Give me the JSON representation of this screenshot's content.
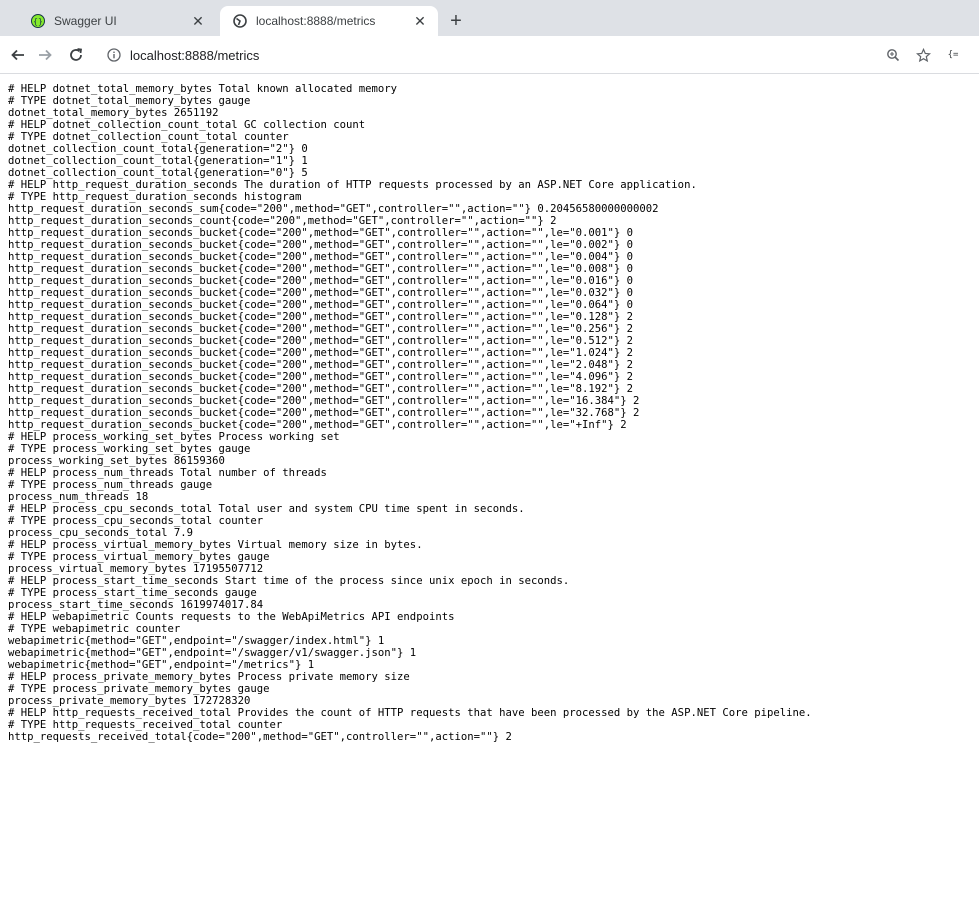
{
  "browser": {
    "tabs": [
      {
        "title": "Swagger UI",
        "active": false,
        "icon": "swagger-icon"
      },
      {
        "title": "localhost:8888/metrics",
        "active": true,
        "icon": "globe-icon"
      }
    ],
    "url": "localhost:8888/metrics",
    "nav_icons": [
      "back-arrow-icon",
      "forward-arrow-icon",
      "reload-icon",
      "info-icon",
      "zoom-icon",
      "star-icon",
      "extension-icon"
    ],
    "colors": {
      "tabstrip": "#dee1e6",
      "swagger_green": "#85ea2d",
      "swagger_dark": "#173647"
    }
  },
  "metrics_lines": [
    "# HELP dotnet_total_memory_bytes Total known allocated memory",
    "# TYPE dotnet_total_memory_bytes gauge",
    "dotnet_total_memory_bytes 2651192",
    "# HELP dotnet_collection_count_total GC collection count",
    "# TYPE dotnet_collection_count_total counter",
    "dotnet_collection_count_total{generation=\"2\"} 0",
    "dotnet_collection_count_total{generation=\"1\"} 1",
    "dotnet_collection_count_total{generation=\"0\"} 5",
    "# HELP http_request_duration_seconds The duration of HTTP requests processed by an ASP.NET Core application.",
    "# TYPE http_request_duration_seconds histogram",
    "http_request_duration_seconds_sum{code=\"200\",method=\"GET\",controller=\"\",action=\"\"} 0.20456580000000002",
    "http_request_duration_seconds_count{code=\"200\",method=\"GET\",controller=\"\",action=\"\"} 2",
    "http_request_duration_seconds_bucket{code=\"200\",method=\"GET\",controller=\"\",action=\"\",le=\"0.001\"} 0",
    "http_request_duration_seconds_bucket{code=\"200\",method=\"GET\",controller=\"\",action=\"\",le=\"0.002\"} 0",
    "http_request_duration_seconds_bucket{code=\"200\",method=\"GET\",controller=\"\",action=\"\",le=\"0.004\"} 0",
    "http_request_duration_seconds_bucket{code=\"200\",method=\"GET\",controller=\"\",action=\"\",le=\"0.008\"} 0",
    "http_request_duration_seconds_bucket{code=\"200\",method=\"GET\",controller=\"\",action=\"\",le=\"0.016\"} 0",
    "http_request_duration_seconds_bucket{code=\"200\",method=\"GET\",controller=\"\",action=\"\",le=\"0.032\"} 0",
    "http_request_duration_seconds_bucket{code=\"200\",method=\"GET\",controller=\"\",action=\"\",le=\"0.064\"} 0",
    "http_request_duration_seconds_bucket{code=\"200\",method=\"GET\",controller=\"\",action=\"\",le=\"0.128\"} 2",
    "http_request_duration_seconds_bucket{code=\"200\",method=\"GET\",controller=\"\",action=\"\",le=\"0.256\"} 2",
    "http_request_duration_seconds_bucket{code=\"200\",method=\"GET\",controller=\"\",action=\"\",le=\"0.512\"} 2",
    "http_request_duration_seconds_bucket{code=\"200\",method=\"GET\",controller=\"\",action=\"\",le=\"1.024\"} 2",
    "http_request_duration_seconds_bucket{code=\"200\",method=\"GET\",controller=\"\",action=\"\",le=\"2.048\"} 2",
    "http_request_duration_seconds_bucket{code=\"200\",method=\"GET\",controller=\"\",action=\"\",le=\"4.096\"} 2",
    "http_request_duration_seconds_bucket{code=\"200\",method=\"GET\",controller=\"\",action=\"\",le=\"8.192\"} 2",
    "http_request_duration_seconds_bucket{code=\"200\",method=\"GET\",controller=\"\",action=\"\",le=\"16.384\"} 2",
    "http_request_duration_seconds_bucket{code=\"200\",method=\"GET\",controller=\"\",action=\"\",le=\"32.768\"} 2",
    "http_request_duration_seconds_bucket{code=\"200\",method=\"GET\",controller=\"\",action=\"\",le=\"+Inf\"} 2",
    "# HELP process_working_set_bytes Process working set",
    "# TYPE process_working_set_bytes gauge",
    "process_working_set_bytes 86159360",
    "# HELP process_num_threads Total number of threads",
    "# TYPE process_num_threads gauge",
    "process_num_threads 18",
    "# HELP process_cpu_seconds_total Total user and system CPU time spent in seconds.",
    "# TYPE process_cpu_seconds_total counter",
    "process_cpu_seconds_total 7.9",
    "# HELP process_virtual_memory_bytes Virtual memory size in bytes.",
    "# TYPE process_virtual_memory_bytes gauge",
    "process_virtual_memory_bytes 17195507712",
    "# HELP process_start_time_seconds Start time of the process since unix epoch in seconds.",
    "# TYPE process_start_time_seconds gauge",
    "process_start_time_seconds 1619974017.84",
    "# HELP webapimetric Counts requests to the WebApiMetrics API endpoints",
    "# TYPE webapimetric counter",
    "webapimetric{method=\"GET\",endpoint=\"/swagger/index.html\"} 1",
    "webapimetric{method=\"GET\",endpoint=\"/swagger/v1/swagger.json\"} 1",
    "webapimetric{method=\"GET\",endpoint=\"/metrics\"} 1",
    "# HELP process_private_memory_bytes Process private memory size",
    "# TYPE process_private_memory_bytes gauge",
    "process_private_memory_bytes 172728320",
    "# HELP http_requests_received_total Provides the count of HTTP requests that have been processed by the ASP.NET Core pipeline.",
    "# TYPE http_requests_received_total counter",
    "http_requests_received_total{code=\"200\",method=\"GET\",controller=\"\",action=\"\"} 2"
  ]
}
